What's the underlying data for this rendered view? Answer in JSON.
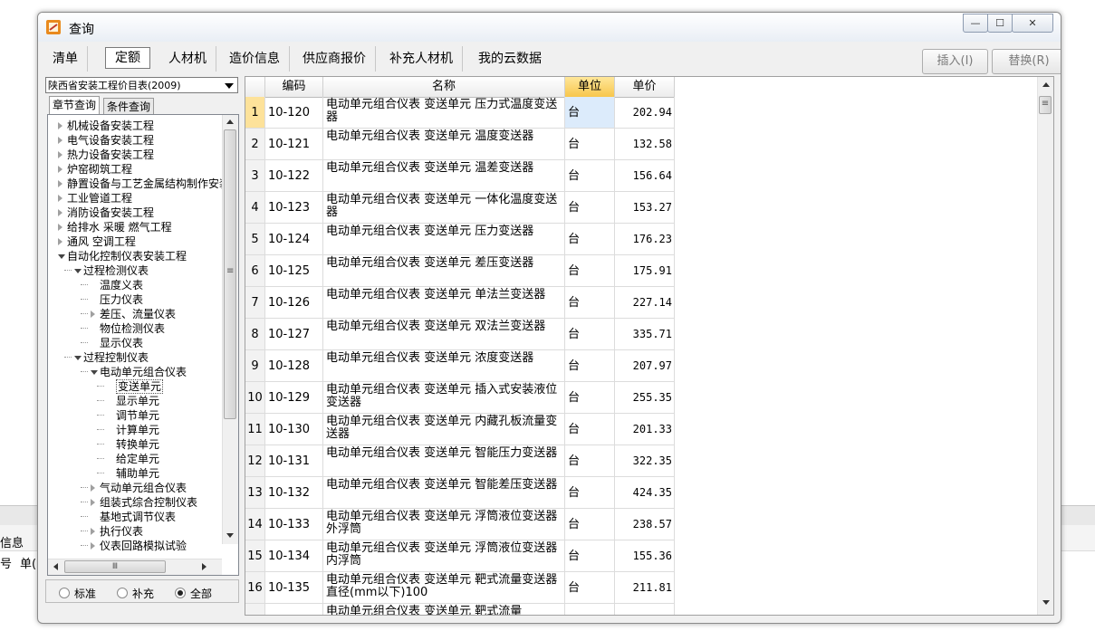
{
  "background": {
    "text1": "信息",
    "text2": "号",
    "text3": "单("
  },
  "window": {
    "title": "查询",
    "min_glyph": "—",
    "max_glyph": "☐",
    "close_glyph": "✕"
  },
  "tabs": [
    {
      "label": "清单"
    },
    {
      "label": "定额"
    },
    {
      "label": "人材机"
    },
    {
      "label": "造价信息"
    },
    {
      "label": "供应商报价"
    },
    {
      "label": "补充人材机"
    },
    {
      "label": "我的云数据"
    }
  ],
  "actions": {
    "insert": "插入(I)",
    "replace": "替换(R)"
  },
  "left": {
    "library": "陕西省安装工程价目表(2009)",
    "subtabs": [
      "章节查询",
      "条件查询"
    ],
    "tree": [
      {
        "label": "机械设备安装工程",
        "level": 0,
        "state": "closed"
      },
      {
        "label": "电气设备安装工程",
        "level": 0,
        "state": "closed"
      },
      {
        "label": "热力设备安装工程",
        "level": 0,
        "state": "closed"
      },
      {
        "label": "炉窑砌筑工程",
        "level": 0,
        "state": "closed"
      },
      {
        "label": "静置设备与工艺金属结构制作安装工程",
        "level": 0,
        "state": "closed"
      },
      {
        "label": "工业管道工程",
        "level": 0,
        "state": "closed"
      },
      {
        "label": "消防设备安装工程",
        "level": 0,
        "state": "closed"
      },
      {
        "label": "给排水 采暖 燃气工程",
        "level": 0,
        "state": "closed"
      },
      {
        "label": "通风 空调工程",
        "level": 0,
        "state": "closed"
      },
      {
        "label": "自动化控制仪表安装工程",
        "level": 0,
        "state": "open"
      },
      {
        "label": "过程检测仪表",
        "level": 1,
        "state": "open"
      },
      {
        "label": "温度义表",
        "level": 2,
        "state": "leaf"
      },
      {
        "label": "压力仪表",
        "level": 2,
        "state": "leaf"
      },
      {
        "label": "差压、流量仪表",
        "level": 2,
        "state": "closed"
      },
      {
        "label": "物位检测仪表",
        "level": 2,
        "state": "leaf"
      },
      {
        "label": "显示仪表",
        "level": 2,
        "state": "leaf"
      },
      {
        "label": "过程控制仪表",
        "level": 1,
        "state": "open"
      },
      {
        "label": "电动单元组合仪表",
        "level": 2,
        "state": "open"
      },
      {
        "label": "变送单元",
        "level": 3,
        "state": "leaf",
        "selected": true
      },
      {
        "label": "显示单元",
        "level": 3,
        "state": "leaf"
      },
      {
        "label": "调节单元",
        "level": 3,
        "state": "leaf"
      },
      {
        "label": "计算单元",
        "level": 3,
        "state": "leaf"
      },
      {
        "label": "转换单元",
        "level": 3,
        "state": "leaf"
      },
      {
        "label": "给定单元",
        "level": 3,
        "state": "leaf"
      },
      {
        "label": "辅助单元",
        "level": 3,
        "state": "leaf"
      },
      {
        "label": "气动单元组合仪表",
        "level": 2,
        "state": "closed"
      },
      {
        "label": "组装式综合控制仪表",
        "level": 2,
        "state": "closed"
      },
      {
        "label": "基地式调节仪表",
        "level": 2,
        "state": "leaf"
      },
      {
        "label": "执行仪表",
        "level": 2,
        "state": "closed"
      },
      {
        "label": "仪表回路模拟试验",
        "level": 2,
        "state": "closed"
      }
    ],
    "hscroll_grip": "Ⅲ",
    "vscroll_grip": "≡",
    "radios": [
      {
        "label": "标准",
        "checked": false
      },
      {
        "label": "补充",
        "checked": false
      },
      {
        "label": "全部",
        "checked": true
      }
    ]
  },
  "grid": {
    "headers": [
      "编码",
      "名称",
      "单位",
      "单价"
    ],
    "rows": [
      {
        "no": "1",
        "code": "10-120",
        "name": "电动单元组合仪表 变送单元 压力式温度变送器",
        "unit": "台",
        "price": "202.94"
      },
      {
        "no": "2",
        "code": "10-121",
        "name": "电动单元组合仪表 变送单元 温度变送器",
        "unit": "台",
        "price": "132.58"
      },
      {
        "no": "3",
        "code": "10-122",
        "name": "电动单元组合仪表 变送单元 温差变送器",
        "unit": "台",
        "price": "156.64"
      },
      {
        "no": "4",
        "code": "10-123",
        "name": "电动单元组合仪表 变送单元 一体化温度变送器",
        "unit": "台",
        "price": "153.27"
      },
      {
        "no": "5",
        "code": "10-124",
        "name": "电动单元组合仪表 变送单元 压力变送器",
        "unit": "台",
        "price": "176.23"
      },
      {
        "no": "6",
        "code": "10-125",
        "name": "电动单元组合仪表 变送单元 差压变送器",
        "unit": "台",
        "price": "175.91"
      },
      {
        "no": "7",
        "code": "10-126",
        "name": "电动单元组合仪表 变送单元 单法兰变送器",
        "unit": "台",
        "price": "227.14"
      },
      {
        "no": "8",
        "code": "10-127",
        "name": "电动单元组合仪表 变送单元 双法兰变送器",
        "unit": "台",
        "price": "335.71"
      },
      {
        "no": "9",
        "code": "10-128",
        "name": "电动单元组合仪表 变送单元 浓度变送器",
        "unit": "台",
        "price": "207.97"
      },
      {
        "no": "10",
        "code": "10-129",
        "name": "电动单元组合仪表 变送单元 插入式安装液位变送器",
        "unit": "台",
        "price": "255.35"
      },
      {
        "no": "11",
        "code": "10-130",
        "name": "电动单元组合仪表 变送单元 内藏孔板流量变送器",
        "unit": "台",
        "price": "201.33"
      },
      {
        "no": "12",
        "code": "10-131",
        "name": "电动单元组合仪表 变送单元 智能压力变送器",
        "unit": "台",
        "price": "322.35"
      },
      {
        "no": "13",
        "code": "10-132",
        "name": "电动单元组合仪表 变送单元 智能差压变送器",
        "unit": "台",
        "price": "424.35"
      },
      {
        "no": "14",
        "code": "10-133",
        "name": "电动单元组合仪表 变送单元 浮筒液位变送器外浮筒",
        "unit": "台",
        "price": "238.57"
      },
      {
        "no": "15",
        "code": "10-134",
        "name": "电动单元组合仪表 变送单元 浮筒液位变送器内浮筒",
        "unit": "台",
        "price": "155.36"
      },
      {
        "no": "16",
        "code": "10-135",
        "name": "电动单元组合仪表 变送单元 靶式流量变送器直径(mm以下)100",
        "unit": "台",
        "price": "211.81"
      },
      {
        "no": "",
        "code": "",
        "name": "电动单元组合仪表 变送单元 靶式流量",
        "unit": "",
        "price": ""
      }
    ]
  },
  "colors": {
    "selected_header": "#f7c64c",
    "current_row": "#fde29a",
    "current_cell": "#dcebfb"
  }
}
